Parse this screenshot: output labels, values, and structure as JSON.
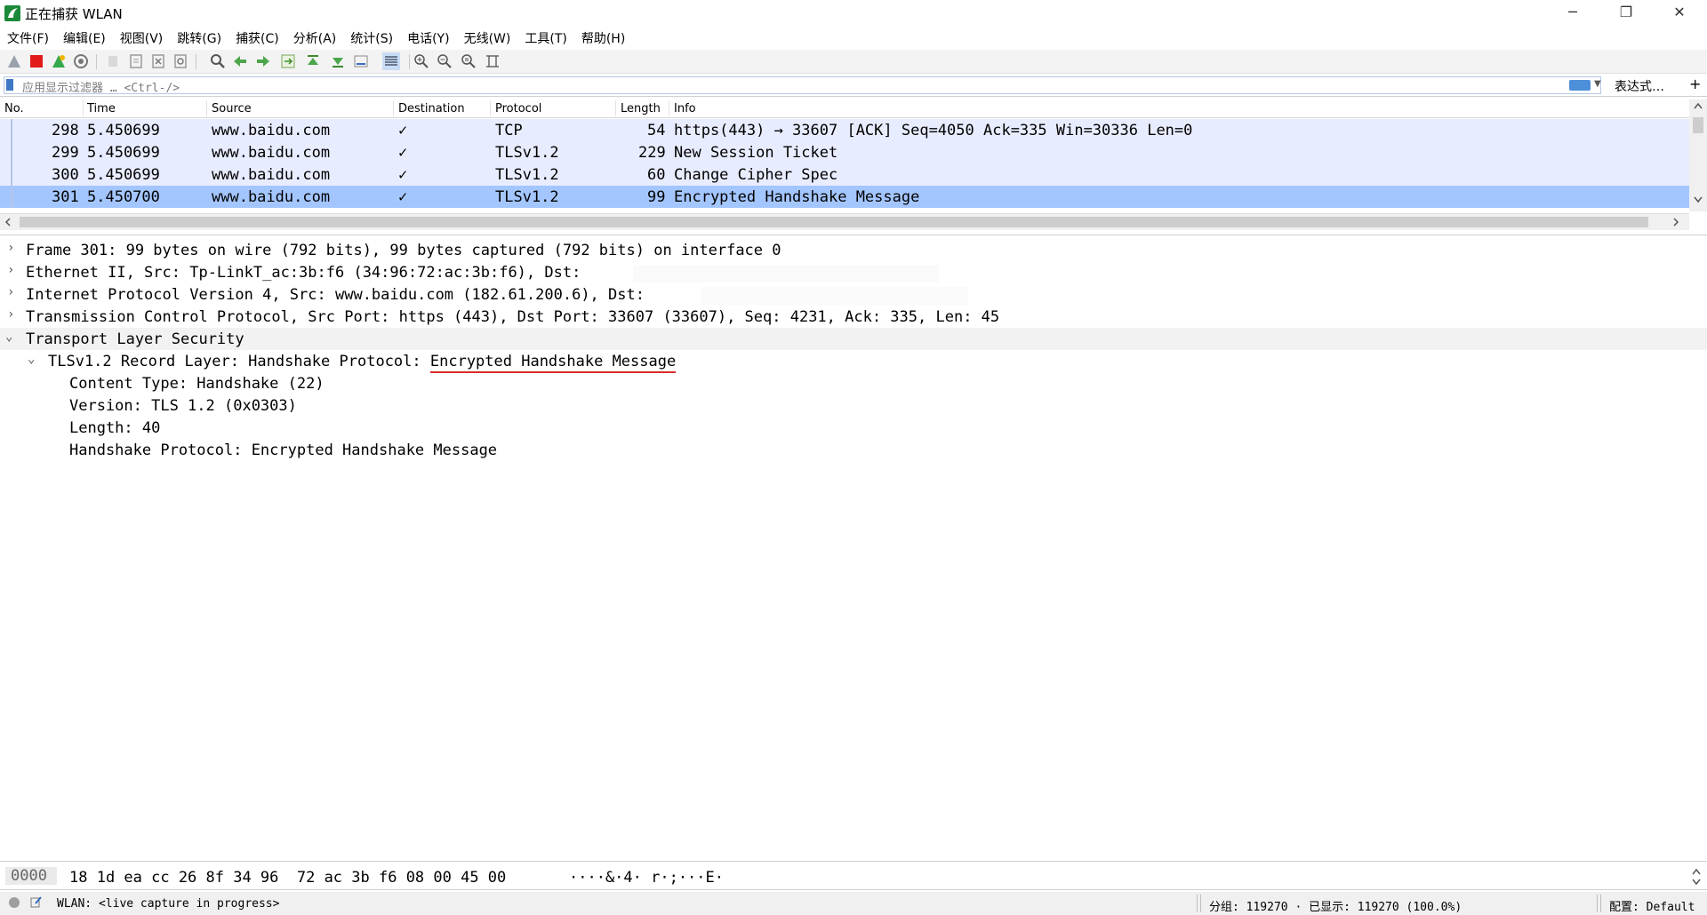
{
  "window": {
    "title": "正在捕获 WLAN",
    "minimize_glyph": "─",
    "maximize_glyph": "❐",
    "close_glyph": "✕",
    "app_icon": "wireshark-fin-icon"
  },
  "menu": [
    "文件(F)",
    "编辑(E)",
    "视图(V)",
    "跳转(G)",
    "捕获(C)",
    "分析(A)",
    "统计(S)",
    "电话(Y)",
    "无线(W)",
    "工具(T)",
    "帮助(H)"
  ],
  "filter": {
    "placeholder": "应用显示过滤器 … <Ctrl-/>",
    "expression_label": "表达式…",
    "add_label": "+"
  },
  "packet_list": {
    "columns": [
      "No.",
      "Time",
      "Source",
      "Destination",
      "Protocol",
      "Length",
      "Info"
    ],
    "rows": [
      {
        "no": "298",
        "time": "5.450699",
        "source": "www.baidu.com",
        "destination": "✓",
        "protocol": "TCP",
        "length": "54",
        "info": "https(443) → 33607 [ACK] Seq=4050 Ack=335 Win=30336 Len=0"
      },
      {
        "no": "299",
        "time": "5.450699",
        "source": "www.baidu.com",
        "destination": "✓",
        "protocol": "TLSv1.2",
        "length": "229",
        "info": "New Session Ticket"
      },
      {
        "no": "300",
        "time": "5.450699",
        "source": "www.baidu.com",
        "destination": "✓",
        "protocol": "TLSv1.2",
        "length": "60",
        "info": "Change Cipher Spec"
      },
      {
        "no": "301",
        "time": "5.450700",
        "source": "www.baidu.com",
        "destination": "✓",
        "protocol": "TLSv1.2",
        "length": "99",
        "info": "Encrypted Handshake Message"
      }
    ],
    "selected_row_color": "#a4c6ff",
    "row_color": "#e8ecff"
  },
  "details": {
    "frame": "Frame 301: 99 bytes on wire (792 bits), 99 bytes captured (792 bits) on interface 0",
    "ethernet": "Ethernet II, Src: Tp-LinkT_ac:3b:f6 (34:96:72:ac:3b:f6), Dst:",
    "ip": "Internet Protocol Version 4, Src: www.baidu.com (182.61.200.6), Dst:",
    "tcp": "Transmission Control Protocol, Src Port: https (443), Dst Port: 33607 (33607), Seq: 4231, Ack: 335, Len: 45",
    "tls": "Transport Layer Security",
    "record_prefix": "TLSv1.2 Record Layer: Handshake Protocol: ",
    "record_highlight": "Encrypted Handshake Message",
    "content_type": "Content Type: Handshake (22)",
    "version": "Version: TLS 1.2 (0x0303)",
    "length": "Length: 40",
    "handshake": "Handshake Protocol: Encrypted Handshake Message",
    "collapsed_glyph": "›",
    "expanded_glyph": "⌄",
    "underline_color": "#d92b2b"
  },
  "bytes": {
    "offset": "0000",
    "hex": "18 1d ea cc 26 8f 34 96  72 ac 3b f6 08 00 45 00",
    "ascii": "····&·4· r·;···E·"
  },
  "status": {
    "capture": "WLAN: <live capture in progress>",
    "packets": "分组: 119270 · 已显示: 119270 (100.0%)",
    "profile": "配置: Default"
  }
}
